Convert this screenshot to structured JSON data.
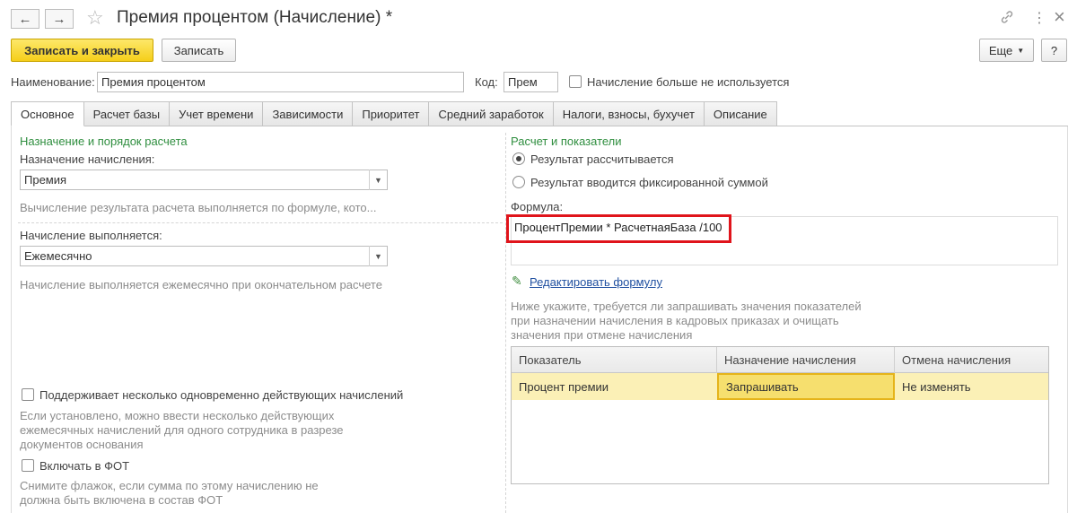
{
  "window": {
    "title": "Премия процентом (Начисление) *",
    "back_icon": "←",
    "forward_icon": "→",
    "star_icon": "☆",
    "link_icon": "🔗",
    "more_icon": "⋮",
    "close_icon": "×"
  },
  "toolbar": {
    "save_close_label": "Записать и закрыть",
    "save_label": "Записать",
    "more_label": "Еще",
    "help_label": "?"
  },
  "header": {
    "name_label": "Наименование:",
    "name_value": "Премия процентом",
    "code_label": "Код:",
    "code_value": "Прем",
    "unused_label": "Начисление больше не используется"
  },
  "tabs": [
    {
      "label": "Основное",
      "active": true
    },
    {
      "label": "Расчет базы"
    },
    {
      "label": "Учет времени"
    },
    {
      "label": "Зависимости"
    },
    {
      "label": "Приоритет"
    },
    {
      "label": "Средний заработок"
    },
    {
      "label": "Налоги, взносы, бухучет"
    },
    {
      "label": "Описание"
    }
  ],
  "left": {
    "section_title": "Назначение и порядок расчета",
    "purpose_label": "Назначение начисления:",
    "purpose_value": "Премия",
    "purpose_hint": "Вычисление результата расчета выполняется по формуле, кото...",
    "execution_label": "Начисление выполняется:",
    "execution_value": "Ежемесячно",
    "execution_hint": "Начисление выполняется ежемесячно при окончательном расчете",
    "multi_label": "Поддерживает несколько одновременно действующих начислений",
    "multi_hint_1": "Если установлено, можно ввести несколько действующих",
    "multi_hint_2": "ежемесячных начислений для одного сотрудника в разрезе",
    "multi_hint_3": "документов основания",
    "fot_label": "Включать в ФОТ",
    "fot_hint_1": "Снимите флажок, если сумма по этому начислению не",
    "fot_hint_2": "должна быть включена в состав ФОТ"
  },
  "right": {
    "section_title": "Расчет и показатели",
    "radio_calc": "Результат рассчитывается",
    "radio_fixed": "Результат вводится фиксированной суммой",
    "formula_label": "Формула:",
    "formula_value": "ПроцентПремии * РасчетнаяБаза /100",
    "edit_formula_link": "Редактировать формулу",
    "edit_icon": "✎",
    "indicators_hint_1": "Ниже укажите, требуется ли запрашивать значения показателей",
    "indicators_hint_2": "при назначении начисления в кадровых приказах и очищать",
    "indicators_hint_3": "значения при отмене начисления"
  },
  "table": {
    "columns": [
      "Показатель",
      "Назначение начисления",
      "Отмена начисления"
    ],
    "rows": [
      [
        "Процент премии",
        "Запрашивать",
        "Не изменять"
      ]
    ]
  },
  "colors": {
    "accent_green": "#2f8e3f",
    "primary_button": "#f5ce1a",
    "highlight_red": "#e0141b",
    "row_selected": "#fbf0b6"
  }
}
